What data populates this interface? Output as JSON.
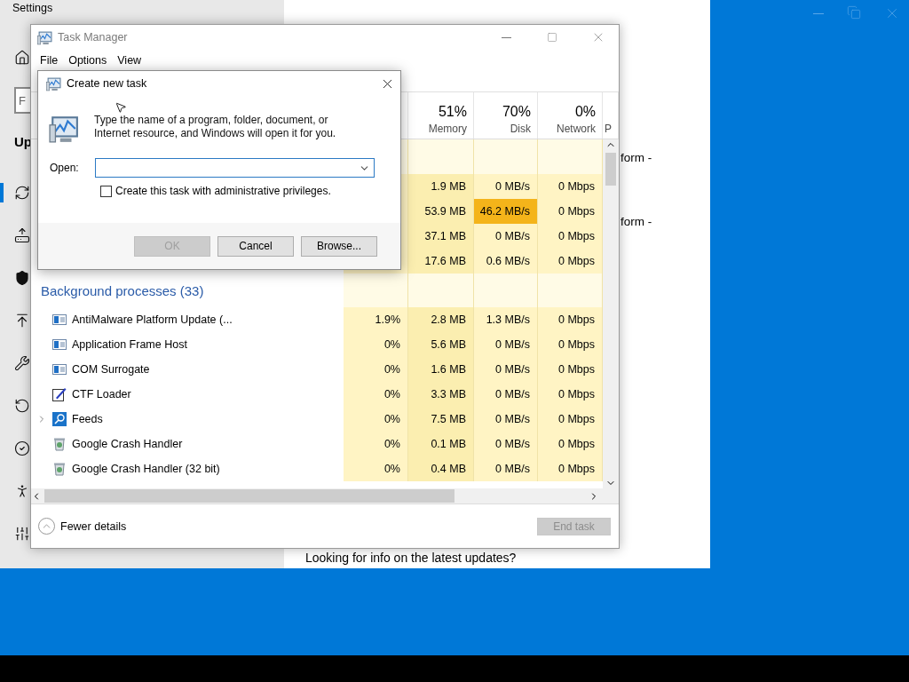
{
  "settings": {
    "title": "Settings",
    "home": {
      "kind": "home",
      "selected": false
    },
    "search": {
      "placeholder": "F"
    },
    "heading": "Up",
    "nav": [
      {
        "kind": "sync",
        "selected": true
      },
      {
        "kind": "delivery",
        "selected": false
      },
      {
        "kind": "security",
        "selected": false
      },
      {
        "kind": "backup",
        "selected": false
      },
      {
        "kind": "troubleshoot",
        "selected": false
      },
      {
        "kind": "recovery",
        "selected": false
      },
      {
        "kind": "activation",
        "selected": false
      },
      {
        "kind": "find",
        "selected": false
      },
      {
        "kind": "developer",
        "selected": false
      }
    ],
    "content_texts": [
      "form -",
      "form -"
    ],
    "footer_text": "Looking for info on the latest updates?"
  },
  "task_manager": {
    "title": "Task Manager",
    "menu": [
      "File",
      "Options",
      "View"
    ],
    "columns": [
      {
        "percent": "51%",
        "label": "Memory"
      },
      {
        "percent": "70%",
        "label": "Disk"
      },
      {
        "percent": "0%",
        "label": "Network"
      },
      {
        "label": "P"
      }
    ],
    "app_rows": [
      {
        "memory": "1.9 MB",
        "disk": "0 MB/s",
        "disk_highlighted": false,
        "network": "0 Mbps"
      },
      {
        "memory": "53.9 MB",
        "disk": "46.2 MB/s",
        "disk_highlighted": true,
        "network": "0 Mbps"
      },
      {
        "memory": "37.1 MB",
        "disk": "0 MB/s",
        "disk_highlighted": false,
        "network": "0 Mbps"
      },
      {
        "memory": "17.6 MB",
        "disk": "0.6 MB/s",
        "disk_highlighted": false,
        "network": "0 Mbps"
      }
    ],
    "group": "Background processes (33)",
    "rows": [
      {
        "name": "AntiMalware Platform Update (...",
        "kind": "app",
        "expandable": false,
        "cpu": "1.9%",
        "memory": "2.8 MB",
        "disk": "1.3 MB/s",
        "network": "0 Mbps"
      },
      {
        "name": "Application Frame Host",
        "kind": "app",
        "expandable": false,
        "cpu": "0%",
        "memory": "5.6 MB",
        "disk": "0 MB/s",
        "network": "0 Mbps"
      },
      {
        "name": "COM Surrogate",
        "kind": "app",
        "expandable": false,
        "cpu": "0%",
        "memory": "1.6 MB",
        "disk": "0 MB/s",
        "network": "0 Mbps"
      },
      {
        "name": "CTF Loader",
        "kind": "pen",
        "expandable": false,
        "cpu": "0%",
        "memory": "3.3 MB",
        "disk": "0 MB/s",
        "network": "0 Mbps"
      },
      {
        "name": "Feeds",
        "kind": "search",
        "expandable": true,
        "cpu": "0%",
        "memory": "7.5 MB",
        "disk": "0 MB/s",
        "network": "0 Mbps"
      },
      {
        "name": "Google Crash Handler",
        "kind": "crash",
        "expandable": false,
        "cpu": "0%",
        "memory": "0.1 MB",
        "disk": "0 MB/s",
        "network": "0 Mbps"
      },
      {
        "name": "Google Crash Handler (32 bit)",
        "kind": "crash",
        "expandable": false,
        "cpu": "0%",
        "memory": "0.4 MB",
        "disk": "0 MB/s",
        "network": "0 Mbps"
      }
    ],
    "fewer_details": "Fewer details",
    "end_task": {
      "label": "End task",
      "disabled": true
    }
  },
  "dialog": {
    "title": "Create new task",
    "message": "Type the name of a program, folder, document, or Internet resource, and Windows will open it for you.",
    "open_label": "Open:",
    "admin_label": "Create this task with administrative privileges.",
    "admin_checked": false,
    "buttons": [
      {
        "label": "OK",
        "disabled": true
      },
      {
        "label": "Cancel",
        "disabled": false
      },
      {
        "label": "Browse...",
        "disabled": false
      }
    ]
  }
}
